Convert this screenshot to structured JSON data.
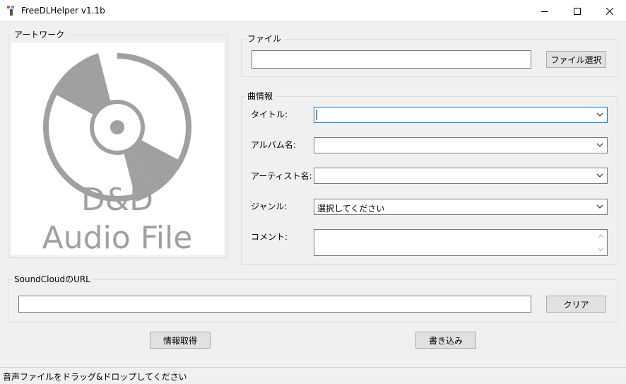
{
  "window": {
    "title": "FreeDLHelper v1.1b"
  },
  "artwork": {
    "group_label": "アートワーク",
    "placeholder_line1": "D&D",
    "placeholder_line2": "Audio File"
  },
  "file": {
    "group_label": "ファイル",
    "path_value": "",
    "select_button": "ファイル選択"
  },
  "song_info": {
    "group_label": "曲情報",
    "title_label": "タイトル:",
    "title_value": "",
    "album_label": "アルバム名:",
    "album_value": "",
    "artist_label": "アーティスト名:",
    "artist_value": "",
    "genre_label": "ジャンル:",
    "genre_value": "選択してください",
    "comment_label": "コメント:",
    "comment_value": ""
  },
  "soundcloud": {
    "group_label": "SoundCloudのURL",
    "url_value": "",
    "clear_button": "クリア"
  },
  "actions": {
    "fetch_info": "情報取得",
    "write": "書き込み"
  },
  "status": {
    "text": "音声ファイルをドラッグ&ドロップしてください"
  },
  "colors": {
    "focus_border": "#0078d7",
    "disc_gray": "#a0a0a0"
  }
}
